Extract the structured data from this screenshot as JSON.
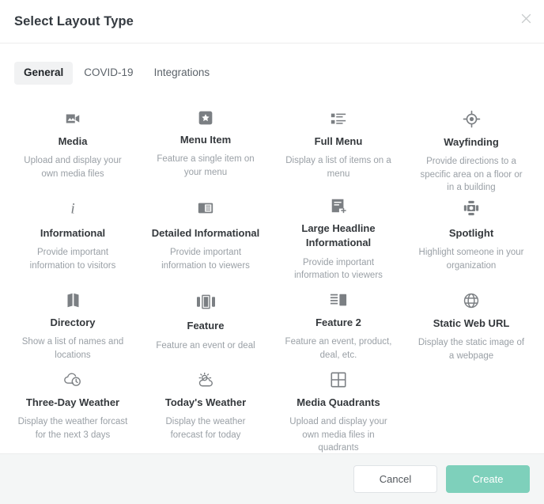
{
  "dialog": {
    "title": "Select Layout Type",
    "close_icon": "close-icon"
  },
  "tabs": [
    {
      "label": "General",
      "active": true
    },
    {
      "label": "COVID-19",
      "active": false
    },
    {
      "label": "Integrations",
      "active": false
    }
  ],
  "layouts": [
    {
      "icon": "video-camera-icon",
      "title": "Media",
      "desc": "Upload and display your own media files"
    },
    {
      "icon": "star-square-icon",
      "title": "Menu Item",
      "desc": "Feature a single item on your menu"
    },
    {
      "icon": "list-detail-icon",
      "title": "Full Menu",
      "desc": "Display a list of items on a menu"
    },
    {
      "icon": "crosshair-target-icon",
      "title": "Wayfinding",
      "desc": "Provide directions to a specific area on a floor or in a building"
    },
    {
      "icon": "information-italic-i-icon",
      "title": "Informational",
      "desc": "Provide important information to visitors"
    },
    {
      "icon": "document-panel-icon",
      "title": "Detailed Informational",
      "desc": "Provide important information to viewers"
    },
    {
      "icon": "headline-plus-icon",
      "title": "Large Headline Informational",
      "desc": "Provide important information to viewers"
    },
    {
      "icon": "spotlight-icon",
      "title": "Spotlight",
      "desc": "Highlight someone in your organization"
    },
    {
      "icon": "map-folded-icon",
      "title": "Directory",
      "desc": "Show a list of names and locations"
    },
    {
      "icon": "carousel-panels-icon",
      "title": "Feature",
      "desc": "Feature an event or deal"
    },
    {
      "icon": "text-block-panel-icon",
      "title": "Feature 2",
      "desc": "Feature an event, product, deal, etc."
    },
    {
      "icon": "globe-icon",
      "title": "Static Web URL",
      "desc": "Display the static image of a webpage"
    },
    {
      "icon": "cloud-clock-icon",
      "title": "Three-Day Weather",
      "desc": "Display the weather forcast for the next 3 days"
    },
    {
      "icon": "sun-cloud-icon",
      "title": "Today's Weather",
      "desc": "Display the weather forecast for today"
    },
    {
      "icon": "grid-quadrants-icon",
      "title": "Media Quadrants",
      "desc": "Upload and display your own media files in quadrants"
    }
  ],
  "footer": {
    "cancel_label": "Cancel",
    "create_label": "Create"
  },
  "colors": {
    "create_button": "#7ed0bb",
    "tab_active_bg": "#f1f2f3",
    "footer_bg": "#f4f6f6",
    "icon": "#7b7f83",
    "title_text": "#34383c",
    "desc_text": "#9aa0a6"
  }
}
